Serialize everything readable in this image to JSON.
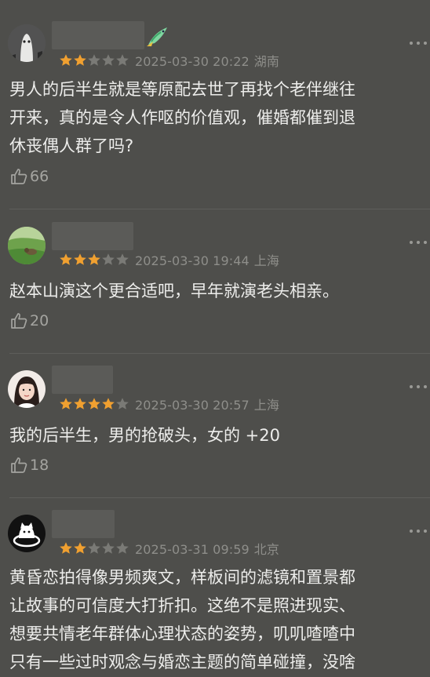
{
  "comments": [
    {
      "rating": 2,
      "date": "2025-03-30 20:22",
      "location": "湖南",
      "lines": [
        "男人的后半生就是等原配去世了再找个老伴继往",
        "开来，真的是令人作呕的价值观，催婚都催到退",
        "休丧偶人群了吗?"
      ],
      "likes": "66",
      "avatar": "ghost-avatar",
      "badge": "green-bird-badge"
    },
    {
      "rating": 3,
      "date": "2025-03-30 19:44",
      "location": "上海",
      "lines": [
        "赵本山演这个更合适吧，早年就演老头相亲。"
      ],
      "likes": "20",
      "avatar": "landscape-avatar"
    },
    {
      "rating": 4,
      "date": "2025-03-30 20:57",
      "location": "上海",
      "lines": [
        "我的后半生，男的抢破头，女的 +20"
      ],
      "likes": "18",
      "avatar": "girl-avatar"
    },
    {
      "rating": 2,
      "date": "2025-03-31 09:59",
      "location": "北京",
      "lines": [
        "黄昏恋拍得像男频爽文，样板间的滤镜和置景都",
        "让故事的可信度大打折扣。这绝不是照进现实、",
        "想要共情老年群体心理状态的姿势，叽叽喳喳中",
        "只有一些过时观念与婚恋主题的简单碰撞，没啥"
      ],
      "avatar": "cat-avatar"
    }
  ],
  "colors": {
    "background": "#4e4e4b",
    "star_filled": "#f0a030",
    "star_empty": "#7a7a76",
    "meta_text": "#8e8e8a"
  }
}
